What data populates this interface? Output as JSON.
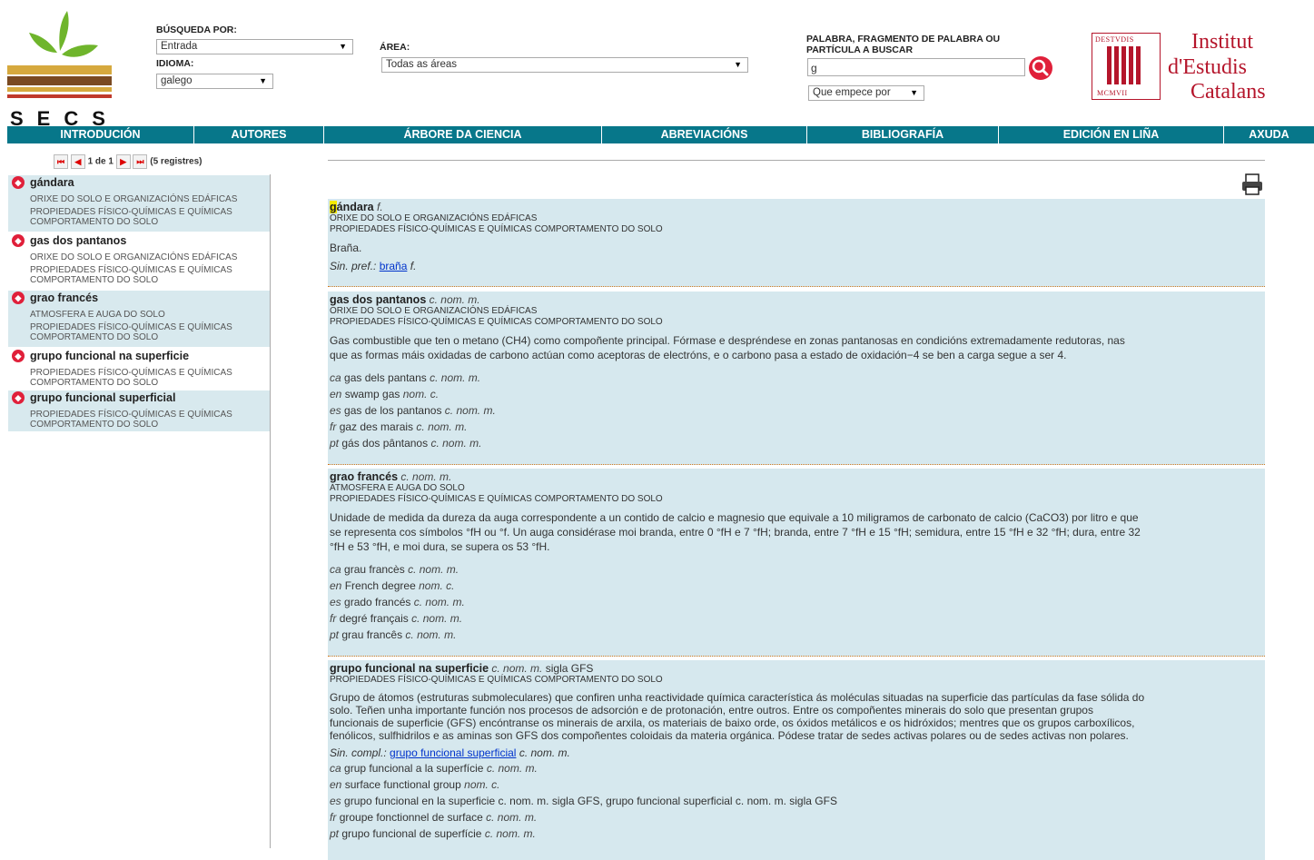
{
  "logo_left": {
    "text": "SECS"
  },
  "logo_right": {
    "line1": "Institut",
    "line2": "d'Estudis",
    "line3": "Catalans",
    "seal_text": "DESTVDIS CATALANS MCMVII"
  },
  "search": {
    "busqueda_label": "BÚSQUEDA POR:",
    "busqueda_value": "Entrada",
    "idioma_label": "IDIOMA:",
    "idioma_value": "galego",
    "area_label": "ÁREA:",
    "area_value": "Todas as áreas",
    "palabra_label": "PALABRA, FRAGMENTO DE PALABRA OU PARTÍCULA A BUSCAR",
    "palabra_value": "g",
    "mode_value": "Que empece por"
  },
  "nav": [
    "INTRODUCIÓN",
    "AUTORES",
    "ÁRBORE DA CIENCIA",
    "ABREVIACIÓNS",
    "BIBLIOGRAFÍA",
    "EDICIÓN EN LIÑA",
    "AXUDA"
  ],
  "pager": {
    "page": "1 de 1",
    "count": "(5 registres)"
  },
  "list": [
    {
      "term": "gándara",
      "subs": [
        "ORIXE DO SOLO E ORGANIZACIÓNS EDÁFICAS",
        "PROPIEDADES FÍSICO-QUÍMICAS E QUÍMICAS",
        "COMPORTAMENTO DO SOLO"
      ]
    },
    {
      "term": "gas dos pantanos",
      "subs": [
        "ORIXE DO SOLO E ORGANIZACIÓNS EDÁFICAS",
        "PROPIEDADES FÍSICO-QUÍMICAS E QUÍMICAS",
        "COMPORTAMENTO DO SOLO"
      ]
    },
    {
      "term": "grao francés",
      "subs": [
        "ATMOSFERA E AUGA DO SOLO",
        "PROPIEDADES FÍSICO-QUÍMICAS E QUÍMICAS",
        "COMPORTAMENTO DO SOLO"
      ]
    },
    {
      "term": "grupo funcional na superficie",
      "subs": [
        "PROPIEDADES FÍSICO-QUÍMICAS E QUÍMICAS",
        "COMPORTAMENTO DO SOLO"
      ]
    },
    {
      "term": "grupo funcional superficial",
      "subs": [
        "PROPIEDADES FÍSICO-QUÍMICAS E QUÍMICAS",
        "COMPORTAMENTO DO SOLO"
      ]
    }
  ],
  "entries": {
    "e1": {
      "term_hl": "g",
      "term_rest": "ándara",
      "gram": "f.",
      "area1": "ORIXE DO SOLO E ORGANIZACIÓNS EDÁFICAS",
      "area2": "PROPIEDADES FÍSICO-QUÍMICAS E QUÍMICAS COMPORTAMENTO DO SOLO",
      "def": "Braña.",
      "sin_label": "Sin. pref.:",
      "sin_link": "braña",
      "sin_gram": "f."
    },
    "e2": {
      "term": "gas dos pantanos",
      "gram": "c. nom. m.",
      "area1": "ORIXE DO SOLO E ORGANIZACIÓNS EDÁFICAS",
      "area2": "PROPIEDADES FÍSICO-QUÍMICAS E QUÍMICAS COMPORTAMENTO DO SOLO",
      "def1": "Gas combustible que ten o metano (CH4) como compoñente principal. Fórmase e despréndese en zonas pantanosas en condicións extremadamente redutoras, nas",
      "def2": "que as formas máis oxidadas de carbono actúan como aceptoras de electróns, e o carbono pasa a estado de oxidación−4 se ben a carga segue a ser 4.",
      "eq": [
        {
          "lang": "ca",
          "text": "gas dels pantans",
          "gram": "c. nom. m."
        },
        {
          "lang": "en",
          "text": "swamp gas",
          "gram": "nom. c."
        },
        {
          "lang": "es",
          "text": "gas de los pantanos",
          "gram": "c. nom. m."
        },
        {
          "lang": "fr",
          "text": "gaz des marais",
          "gram": "c. nom. m."
        },
        {
          "lang": "pt",
          "text": "gás dos pântanos",
          "gram": "c. nom. m."
        }
      ]
    },
    "e3": {
      "term": "grao francés",
      "gram": "c. nom. m.",
      "area1": "ATMOSFERA E AUGA DO SOLO",
      "area2": "PROPIEDADES FÍSICO-QUÍMICAS E QUÍMICAS COMPORTAMENTO DO SOLO",
      "def1": "Unidade de medida da dureza da auga correspondente a un contido de calcio e magnesio que equivale a 10 miligramos de carbonato de calcio (CaCO3) por litro e que",
      "def2": "se representa cos símbolos °fH ou °f. Un auga considérase moi branda, entre 0 °fH e 7 °fH; branda, entre 7 °fH e 15 °fH; semidura, entre 15 °fH e 32 °fH; dura, entre 32",
      "def3": "°fH e 53 °fH, e moi dura, se supera os 53 °fH.",
      "eq": [
        {
          "lang": "ca",
          "text": "grau francès",
          "gram": "c. nom. m."
        },
        {
          "lang": "en",
          "text": "French degree",
          "gram": "nom. c."
        },
        {
          "lang": "es",
          "text": "grado francés",
          "gram": "c. nom. m."
        },
        {
          "lang": "fr",
          "text": "degré français",
          "gram": "c. nom. m."
        },
        {
          "lang": "pt",
          "text": "grau francês",
          "gram": "c. nom. m."
        }
      ]
    },
    "e4": {
      "term": "grupo funcional na superficie",
      "gram": "c. nom. m.",
      "sigla_label": "sigla",
      "sigla": "GFS",
      "area1": "PROPIEDADES FÍSICO-QUÍMICAS E QUÍMICAS COMPORTAMENTO DO SOLO",
      "def1": "Grupo de átomos (estruturas submoleculares) que confiren unha reactividade química característica ás moléculas situadas na superficie das partículas da fase sólida do",
      "def2": "solo. Teñen unha importante función nos procesos de adsorción e de protonación, entre outros. Entre os compoñentes minerais do solo que presentan grupos",
      "def3": "funcionais de superficie (GFS) encóntranse os minerais de arxila, os materiais de baixo orde, os óxidos metálicos e os hidróxidos; mentres que os grupos carboxílicos,",
      "def4": "fenólicos, sulfhidrilos e as aminas son GFS dos compoñentes coloidais da materia orgánica. Pódese tratar de sedes activas polares ou de sedes activas non polares.",
      "sin_label": "Sin. compl.:",
      "sin_link": "grupo funcional superficial",
      "sin_gram": "c. nom. m.",
      "eq": [
        {
          "lang": "ca",
          "text": "grup funcional a la superfície",
          "gram": "c. nom. m."
        },
        {
          "lang": "en",
          "text": "surface functional group",
          "gram": "nom. c."
        },
        {
          "lang": "es",
          "text": "grupo funcional en la superficie c. nom. m. sigla GFS, grupo funcional superficial c. nom. m. sigla GFS",
          "gram": ""
        },
        {
          "lang": "fr",
          "text": "groupe fonctionnel de surface",
          "gram": "c. nom. m."
        },
        {
          "lang": "pt",
          "text": "grupo funcional de superfície",
          "gram": "c. nom. m."
        }
      ]
    }
  },
  "colors": {
    "nav": "#07778a",
    "entry_bg": "#d6e8ee",
    "highlight": "#f4e900",
    "accent_red": "#e0203a"
  }
}
